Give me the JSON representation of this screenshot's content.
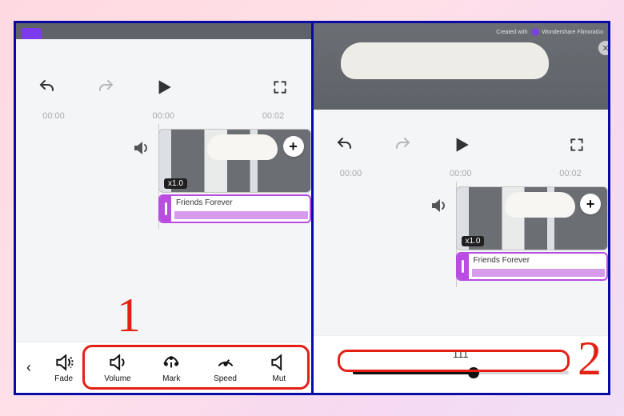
{
  "annotations": {
    "left_number": "1",
    "right_number": "2"
  },
  "left": {
    "times": [
      "00:00",
      "00:00",
      "00:02"
    ],
    "clip_speed_tag": "x1.0",
    "audio_label": "Friends Forever",
    "toolbar": [
      {
        "icon": "fade-icon",
        "label": "Fade"
      },
      {
        "icon": "volume-icon",
        "label": "Volume"
      },
      {
        "icon": "mark-icon",
        "label": "Mark"
      },
      {
        "icon": "speed-icon",
        "label": "Speed"
      },
      {
        "icon": "mute-icon",
        "label": "Mut"
      }
    ]
  },
  "right": {
    "times": [
      "00:00",
      "00:00",
      "00:02"
    ],
    "clip_speed_tag": "x1.0",
    "audio_label": "Friends Forever",
    "slider": {
      "value_label": "111",
      "percent": 56
    },
    "watermark": "Wondershare FilmoraGo",
    "watermark_prefix": "Created with"
  }
}
